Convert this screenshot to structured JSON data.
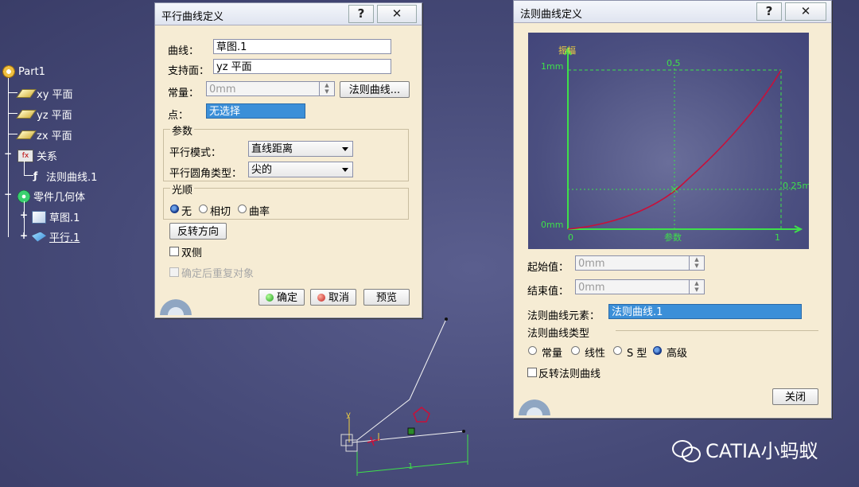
{
  "tree": {
    "root": "Part1",
    "planes": [
      "xy 平面",
      "yz 平面",
      "zx 平面"
    ],
    "relations": "关系",
    "law": "法则曲线.1",
    "body": "零件几何体",
    "sketch": "草图.1",
    "parallel": "平行.1"
  },
  "parallel_dialog": {
    "title": "平行曲线定义",
    "help": "?",
    "close": "✕",
    "curve_label": "曲线：",
    "curve_value": "草图.1",
    "support_label": "支持面：",
    "support_value": "yz 平面",
    "constant_label": "常量：",
    "constant_value": "0mm",
    "law_button": "法则曲线...",
    "point_label": "点：",
    "point_value": "无选择",
    "params_group": "参数",
    "mode_label": "平行模式：",
    "mode_value": "直线距离",
    "corner_label": "平行圆角类型：",
    "corner_value": "尖的",
    "smooth_group": "光顺",
    "smooth_options": [
      "无",
      "相切",
      "曲率"
    ],
    "smooth_selected": "无",
    "reverse_button": "反转方向",
    "both_sides": "双侧",
    "repeat_object": "确定后重复对象",
    "ok": "确定",
    "cancel": "取消",
    "preview": "预览"
  },
  "law_dialog": {
    "title": "法则曲线定义",
    "help": "?",
    "close": "✕",
    "graph": {
      "y_axis_title": "振幅",
      "y_max_label": "1mm",
      "y_mid_label": "0.25mm",
      "y_min_label": "0mm",
      "x_min_label": "0",
      "x_mid_label": "0.5",
      "x_axis_title": "参数",
      "x_max_label": "1",
      "curve_color": "#c8103a",
      "axis_color": "#3ee04a"
    },
    "start_label": "起始值：",
    "start_value": "0mm",
    "end_label": "结束值：",
    "end_value": "0mm",
    "element_label": "法则曲线元素：",
    "element_value": "法则曲线.1",
    "type_group": "法则曲线类型",
    "type_options": [
      "常量",
      "线性",
      "S 型",
      "高级"
    ],
    "type_selected": "高级",
    "reverse_law": "反转法则曲线",
    "close_button": "关闭"
  },
  "watermark": "CATIA小蚂蚁"
}
